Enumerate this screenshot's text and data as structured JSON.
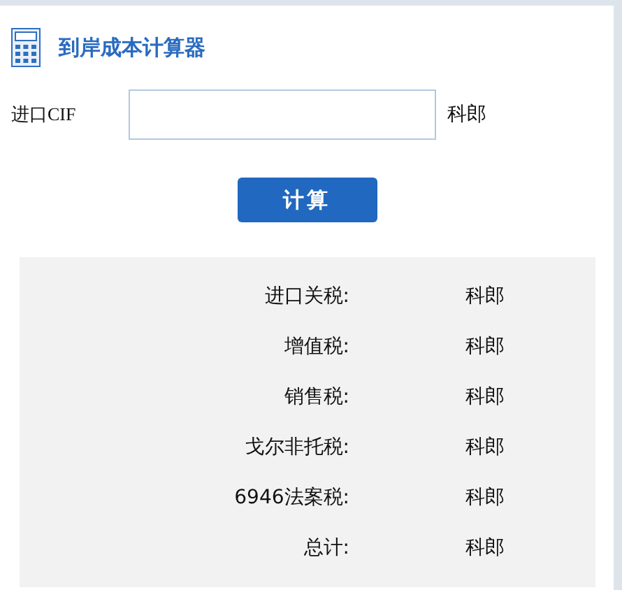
{
  "header": {
    "title": "到岸成本计算器"
  },
  "input": {
    "label": "进口CIF",
    "unit": "科郎"
  },
  "button": {
    "label": "计算"
  },
  "results": [
    {
      "label": "进口关税:",
      "value": "科郎"
    },
    {
      "label": "增值税:",
      "value": "科郎"
    },
    {
      "label": "销售税:",
      "value": "科郎"
    },
    {
      "label": "戈尔非托税:",
      "value": "科郎"
    },
    {
      "label": "6946法案税:",
      "value": "科郎"
    },
    {
      "label": "总计:",
      "value": "科郎"
    }
  ]
}
